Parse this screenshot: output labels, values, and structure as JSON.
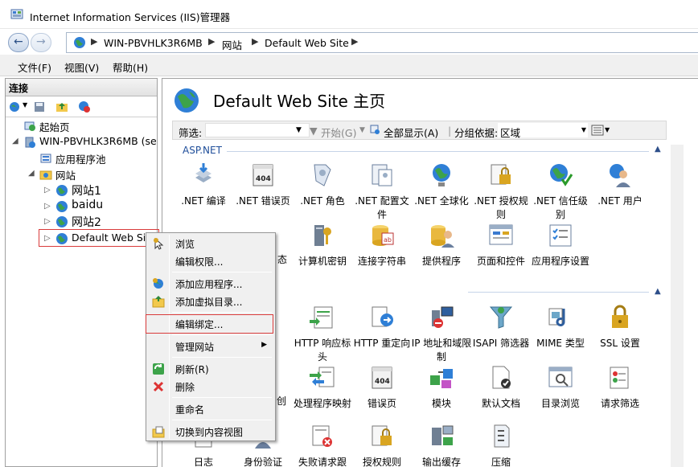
{
  "window": {
    "title": "Internet Information Services (IIS)管理器"
  },
  "address": {
    "crumbs": [
      "WIN-PBVHLK3R6MB",
      "网站",
      "Default Web Site"
    ]
  },
  "menu": [
    "文件(F)",
    "视图(V)",
    "帮助(H)"
  ],
  "connections": {
    "header": "连接",
    "tree": [
      {
        "label": "起始页"
      },
      {
        "label": "WIN-PBVHLK3R6MB (se"
      },
      {
        "label": "应用程序池"
      },
      {
        "label": "网站"
      },
      {
        "label": "网站1"
      },
      {
        "label": "baidu"
      },
      {
        "label": "网站2"
      },
      {
        "label": "Default Web Site"
      }
    ]
  },
  "main": {
    "title": "Default Web Site 主页",
    "filter": {
      "label": "筛选:",
      "start": "开始(G)",
      "show_all": "全部显示(A)",
      "group_label": "分组依据:",
      "group_value": "区域"
    },
    "section1": "ASP.NET",
    "features_row1": [
      {
        "label": ".NET 编译",
        "icon": "net-compile-icon"
      },
      {
        "label": ".NET 错误页",
        "icon": "net-error-pages-icon"
      },
      {
        "label": ".NET 角色",
        "icon": "net-roles-icon"
      },
      {
        "label": ".NET 配置文件",
        "icon": "net-profile-icon"
      },
      {
        "label": ".NET 全球化",
        "icon": "net-globalization-icon"
      },
      {
        "label": ".NET 授权规则",
        "icon": "net-authorization-icon"
      },
      {
        "label": ".NET 信任级别",
        "icon": "net-trust-icon"
      },
      {
        "label": ".NET 用户",
        "icon": "net-users-icon"
      }
    ],
    "features_row2": [
      {
        "label": "计算机密钥",
        "icon": "machine-key-icon"
      },
      {
        "label": "连接字符串",
        "icon": "connection-strings-icon"
      },
      {
        "label": "提供程序",
        "icon": "providers-icon"
      },
      {
        "label": "页面和控件",
        "icon": "pages-controls-icon"
      },
      {
        "label": "应用程序设置",
        "icon": "app-settings-icon"
      }
    ],
    "row2_partial": "态",
    "features_row3": [
      {
        "label": "HTTP 响应标头",
        "icon": "http-headers-icon"
      },
      {
        "label": "HTTP 重定向",
        "icon": "http-redirect-icon"
      },
      {
        "label": "IP 地址和域限制",
        "icon": "ip-restrictions-icon"
      },
      {
        "label": "ISAPI 筛选器",
        "icon": "isapi-filters-icon"
      },
      {
        "label": "MIME 类型",
        "icon": "mime-types-icon"
      },
      {
        "label": "SSL 设置",
        "icon": "ssl-settings-icon"
      }
    ],
    "features_row4": [
      {
        "label": "处理程序映射",
        "icon": "handler-mappings-icon"
      },
      {
        "label": "错误页",
        "icon": "error-pages-icon"
      },
      {
        "label": "模块",
        "icon": "modules-icon"
      },
      {
        "label": "默认文档",
        "icon": "default-document-icon"
      },
      {
        "label": "目录浏览",
        "icon": "directory-browsing-icon"
      },
      {
        "label": "请求筛选",
        "icon": "request-filtering-icon"
      }
    ],
    "row4_partial": "创",
    "features_row5": [
      {
        "label": "日志",
        "icon": "logging-icon"
      },
      {
        "label": "身份验证",
        "icon": "authentication-icon"
      },
      {
        "label": "失败请求跟",
        "icon": "failed-request-icon"
      },
      {
        "label": "授权规则",
        "icon": "authorization-icon"
      },
      {
        "label": "输出缓存",
        "icon": "output-caching-icon"
      },
      {
        "label": "压缩",
        "icon": "compression-icon"
      }
    ]
  },
  "context_menu": {
    "items": [
      "浏览",
      "编辑权限...",
      "添加应用程序...",
      "添加虚拟目录...",
      "编辑绑定...",
      "管理网站",
      "刷新(R)",
      "删除",
      "重命名",
      "切换到内容视图"
    ]
  }
}
